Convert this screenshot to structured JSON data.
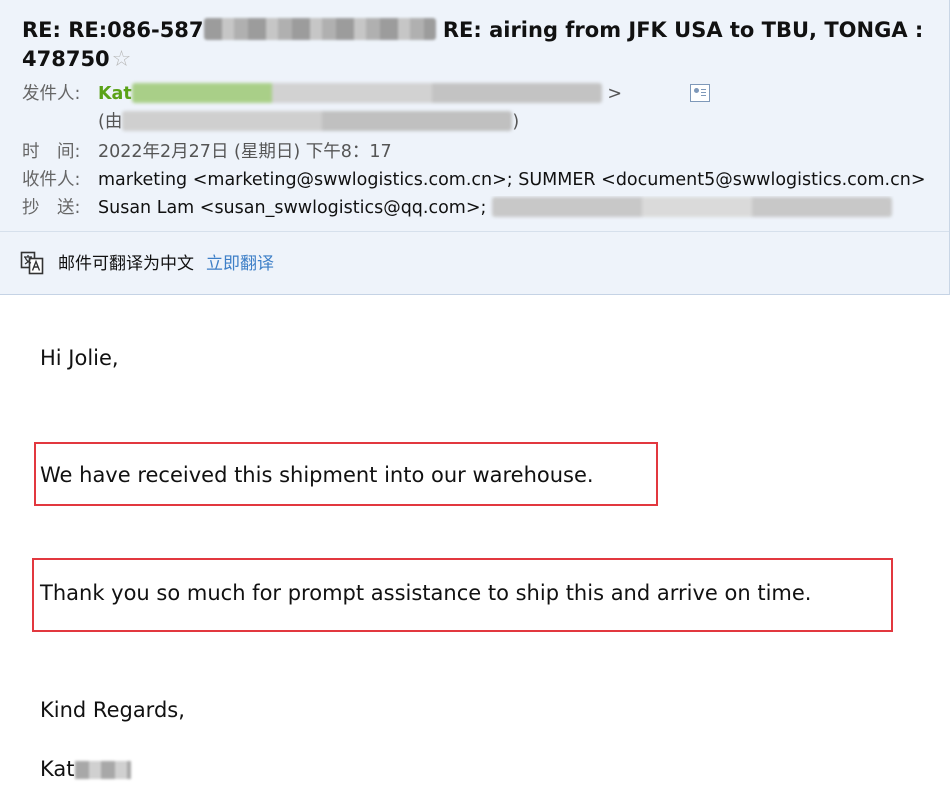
{
  "email": {
    "subject_line1_prefix": "RE: RE:086-587",
    "subject_line1_suffix": "RE: airing from JFK USA to TBU, TONGA :",
    "subject_line2": "478750",
    "star_glyph": "☆",
    "from_label": "发件人:",
    "from_name": "Kat",
    "via_open": "(由",
    "via_close": ")",
    "time_label": "时　间:",
    "time_value": "2022年2月27日 (星期日) 下午8：17",
    "to_label": "收件人:",
    "to_value": "marketing <marketing@swwlogistics.com.cn>; SUMMER <document5@swwlogistics.com.cn>",
    "cc_label": "抄　送:",
    "cc_value": "Susan Lam <susan_swwlogistics@qq.com>;"
  },
  "translate_bar": {
    "icon": "translate-icon",
    "text": "邮件可翻译为中文",
    "link": "立即翻译"
  },
  "body": {
    "greeting": "Hi Jolie,",
    "line1": "We have received this shipment into our warehouse.",
    "line2": "Thank you so much for prompt assistance to ship this and arrive on time.",
    "closing": "Kind Regards,",
    "signature": "Kat"
  },
  "colors": {
    "header_bg": "#eef3fa",
    "sender_name": "#5aa218",
    "link": "#3d7fc7",
    "highlight_box": "#e2383f"
  }
}
